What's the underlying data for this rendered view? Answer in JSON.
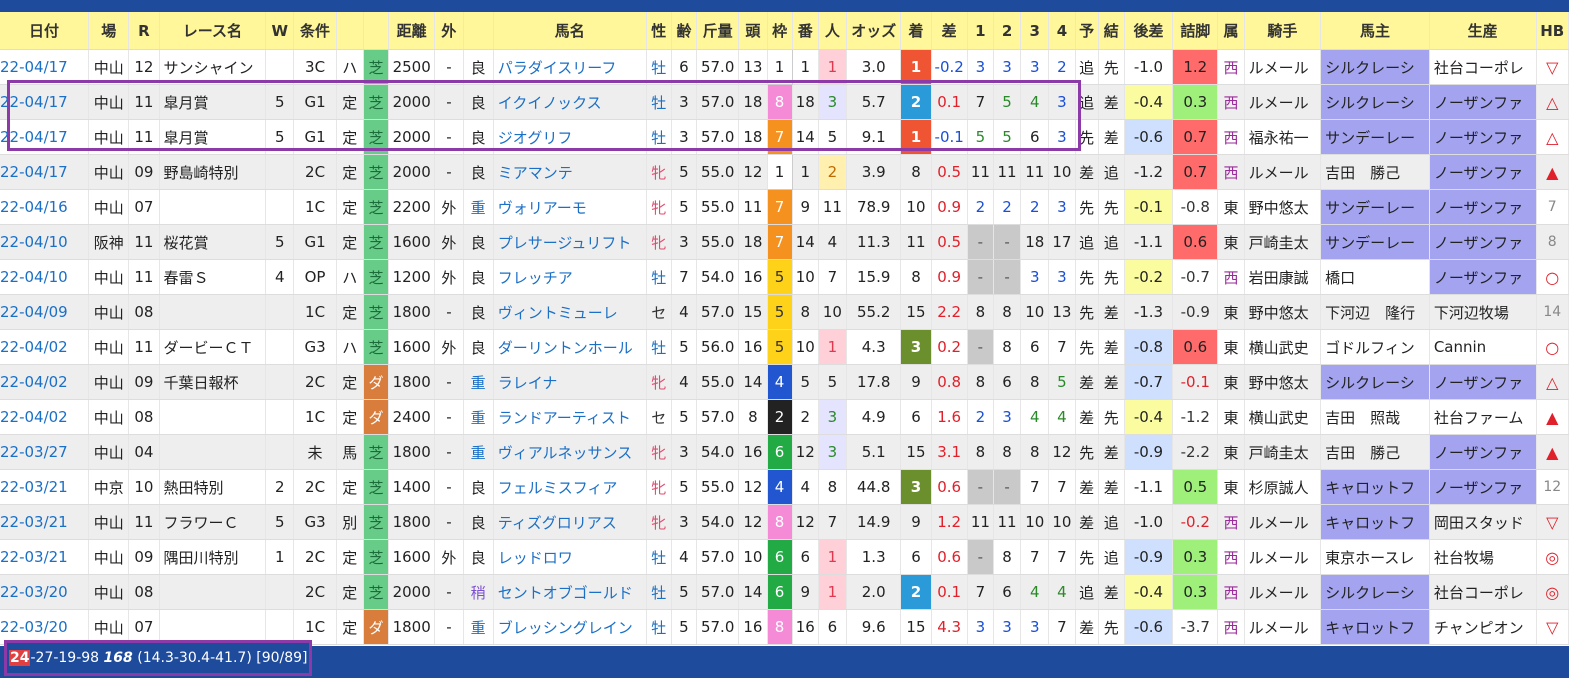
{
  "headers": [
    "日付",
    "場",
    "R",
    "レース名",
    "W",
    "条件",
    "",
    "",
    "距離",
    "外",
    "",
    "馬名",
    "性",
    "齢",
    "斤量",
    "頭",
    "枠",
    "番",
    "人",
    "オッズ",
    "着",
    "差",
    "1",
    "2",
    "3",
    "4",
    "予",
    "結",
    "後差",
    "詰脚",
    "属",
    "騎手",
    "馬主",
    "生産",
    "HB"
  ],
  "rows": [
    {
      "date": "22-04/17",
      "venue": "中山",
      "r": "12",
      "race": "サンシャイン",
      "w": "",
      "grade": "3C",
      "cond": "ハ",
      "surface": "芝",
      "dist": "2500",
      "outer": "-",
      "track": "良",
      "horse": "パラダイスリーフ",
      "sex": "牡",
      "age": "6",
      "weight": "57.0",
      "heads": "13",
      "gate": "1",
      "num": "1",
      "pop": "1",
      "odds": "3.0",
      "finish": "1",
      "diff": "-0.2",
      "c1": "3",
      "c2": "3",
      "c3": "3",
      "c4": "2",
      "pred": "追",
      "res": "先",
      "late": "-1.0",
      "kick": "1.2",
      "belong": "西",
      "jockey": "ルメール",
      "owner": "シルクレーシ",
      "breeder": "社台コーポレ",
      "hb": "▽"
    },
    {
      "date": "22-04/17",
      "venue": "中山",
      "r": "11",
      "race": "皐月賞",
      "w": "5",
      "grade": "G1",
      "cond": "定",
      "surface": "芝",
      "dist": "2000",
      "outer": "-",
      "track": "良",
      "horse": "イクイノックス",
      "sex": "牡",
      "age": "3",
      "weight": "57.0",
      "heads": "18",
      "gate": "8",
      "num": "18",
      "pop": "3",
      "odds": "5.7",
      "finish": "2",
      "diff": "0.1",
      "c1": "7",
      "c2": "5",
      "c3": "4",
      "c4": "3",
      "pred": "追",
      "res": "差",
      "late": "-0.4",
      "kick": "0.3",
      "belong": "西",
      "jockey": "ルメール",
      "owner": "シルクレーシ",
      "breeder": "ノーザンファ",
      "hb": "△"
    },
    {
      "date": "22-04/17",
      "venue": "中山",
      "r": "11",
      "race": "皐月賞",
      "w": "5",
      "grade": "G1",
      "cond": "定",
      "surface": "芝",
      "dist": "2000",
      "outer": "-",
      "track": "良",
      "horse": "ジオグリフ",
      "sex": "牡",
      "age": "3",
      "weight": "57.0",
      "heads": "18",
      "gate": "7",
      "num": "14",
      "pop": "5",
      "odds": "9.1",
      "finish": "1",
      "diff": "-0.1",
      "c1": "5",
      "c2": "5",
      "c3": "6",
      "c4": "3",
      "pred": "先",
      "res": "差",
      "late": "-0.6",
      "kick": "0.7",
      "belong": "西",
      "jockey": "福永祐一",
      "owner": "サンデーレー",
      "breeder": "ノーザンファ",
      "hb": "△"
    },
    {
      "date": "22-04/17",
      "venue": "中山",
      "r": "09",
      "race": "野島崎特別",
      "w": "",
      "grade": "2C",
      "cond": "定",
      "surface": "芝",
      "dist": "2000",
      "outer": "-",
      "track": "良",
      "horse": "ミアマンテ",
      "sex": "牝",
      "age": "5",
      "weight": "55.0",
      "heads": "12",
      "gate": "1",
      "num": "1",
      "pop": "2",
      "odds": "3.9",
      "finish": "8",
      "diff": "0.5",
      "c1": "11",
      "c2": "11",
      "c3": "11",
      "c4": "10",
      "pred": "差",
      "res": "追",
      "late": "-1.2",
      "kick": "0.7",
      "belong": "西",
      "jockey": "ルメール",
      "owner": "吉田　勝己",
      "breeder": "ノーザンファ",
      "hb": "▲"
    },
    {
      "date": "22-04/16",
      "venue": "中山",
      "r": "07",
      "race": "",
      "w": "",
      "grade": "1C",
      "cond": "定",
      "surface": "芝",
      "dist": "2200",
      "outer": "外",
      "track": "重",
      "horse": "ヴォリアーモ",
      "sex": "牝",
      "age": "5",
      "weight": "55.0",
      "heads": "11",
      "gate": "7",
      "num": "9",
      "pop": "11",
      "odds": "78.9",
      "finish": "10",
      "diff": "0.9",
      "c1": "2",
      "c2": "2",
      "c3": "2",
      "c4": "3",
      "pred": "先",
      "res": "先",
      "late": "-0.1",
      "kick": "-0.8",
      "belong": "東",
      "jockey": "野中悠太",
      "owner": "サンデーレー",
      "breeder": "ノーザンファ",
      "hb": "7"
    },
    {
      "date": "22-04/10",
      "venue": "阪神",
      "r": "11",
      "race": "桜花賞",
      "w": "5",
      "grade": "G1",
      "cond": "定",
      "surface": "芝",
      "dist": "1600",
      "outer": "外",
      "track": "良",
      "horse": "プレサージュリフト",
      "sex": "牝",
      "age": "3",
      "weight": "55.0",
      "heads": "18",
      "gate": "7",
      "num": "14",
      "pop": "4",
      "odds": "11.3",
      "finish": "11",
      "diff": "0.5",
      "c1": "-",
      "c2": "-",
      "c3": "18",
      "c4": "17",
      "pred": "追",
      "res": "追",
      "late": "-1.1",
      "kick": "0.6",
      "belong": "東",
      "jockey": "戸崎圭太",
      "owner": "サンデーレー",
      "breeder": "ノーザンファ",
      "hb": "8"
    },
    {
      "date": "22-04/10",
      "venue": "中山",
      "r": "11",
      "race": "春雷Ｓ",
      "w": "4",
      "grade": "OP",
      "cond": "ハ",
      "surface": "芝",
      "dist": "1200",
      "outer": "外",
      "track": "良",
      "horse": "フレッチア",
      "sex": "牡",
      "age": "7",
      "weight": "54.0",
      "heads": "16",
      "gate": "5",
      "num": "10",
      "pop": "7",
      "odds": "15.9",
      "finish": "8",
      "diff": "0.9",
      "c1": "-",
      "c2": "-",
      "c3": "3",
      "c4": "3",
      "pred": "先",
      "res": "先",
      "late": "-0.2",
      "kick": "-0.7",
      "belong": "西",
      "jockey": "岩田康誠",
      "owner": "橋口",
      "breeder": "ノーザンファ",
      "hb": "○"
    },
    {
      "date": "22-04/09",
      "venue": "中山",
      "r": "08",
      "race": "",
      "w": "",
      "grade": "1C",
      "cond": "定",
      "surface": "芝",
      "dist": "1800",
      "outer": "-",
      "track": "良",
      "horse": "ヴィントミューレ",
      "sex": "セ",
      "age": "4",
      "weight": "57.0",
      "heads": "15",
      "gate": "5",
      "num": "8",
      "pop": "10",
      "odds": "55.2",
      "finish": "15",
      "diff": "2.2",
      "c1": "8",
      "c2": "8",
      "c3": "10",
      "c4": "13",
      "pred": "先",
      "res": "差",
      "late": "-1.3",
      "kick": "-0.9",
      "belong": "東",
      "jockey": "野中悠太",
      "owner": "下河辺　隆行",
      "breeder": "下河辺牧場",
      "hb": "14"
    },
    {
      "date": "22-04/02",
      "venue": "中山",
      "r": "11",
      "race": "ダービーＣＴ",
      "w": "",
      "grade": "G3",
      "cond": "ハ",
      "surface": "芝",
      "dist": "1600",
      "outer": "外",
      "track": "良",
      "horse": "ダーリントンホール",
      "sex": "牡",
      "age": "5",
      "weight": "56.0",
      "heads": "16",
      "gate": "5",
      "num": "10",
      "pop": "1",
      "odds": "4.3",
      "finish": "3",
      "diff": "0.2",
      "c1": "-",
      "c2": "8",
      "c3": "6",
      "c4": "7",
      "pred": "先",
      "res": "差",
      "late": "-0.8",
      "kick": "0.6",
      "belong": "東",
      "jockey": "横山武史",
      "owner": "ゴドルフィン",
      "breeder": "Cannin",
      "hb": "○"
    },
    {
      "date": "22-04/02",
      "venue": "中山",
      "r": "09",
      "race": "千葉日報杯",
      "w": "",
      "grade": "2C",
      "cond": "定",
      "surface": "ダ",
      "dist": "1800",
      "outer": "-",
      "track": "重",
      "horse": "ラレイナ",
      "sex": "牝",
      "age": "4",
      "weight": "55.0",
      "heads": "14",
      "gate": "4",
      "num": "5",
      "pop": "5",
      "odds": "17.8",
      "finish": "9",
      "diff": "0.8",
      "c1": "8",
      "c2": "6",
      "c3": "8",
      "c4": "5",
      "pred": "差",
      "res": "差",
      "late": "-0.7",
      "kick": "-0.1",
      "belong": "東",
      "jockey": "野中悠太",
      "owner": "シルクレーシ",
      "breeder": "ノーザンファ",
      "hb": "△"
    },
    {
      "date": "22-04/02",
      "venue": "中山",
      "r": "08",
      "race": "",
      "w": "",
      "grade": "1C",
      "cond": "定",
      "surface": "ダ",
      "dist": "2400",
      "outer": "-",
      "track": "重",
      "horse": "ランドアーティスト",
      "sex": "セ",
      "age": "5",
      "weight": "57.0",
      "heads": "8",
      "gate": "2",
      "num": "2",
      "pop": "3",
      "odds": "4.9",
      "finish": "6",
      "diff": "1.6",
      "c1": "2",
      "c2": "3",
      "c3": "4",
      "c4": "4",
      "pred": "差",
      "res": "先",
      "late": "-0.4",
      "kick": "-1.2",
      "belong": "東",
      "jockey": "横山武史",
      "owner": "吉田　照哉",
      "breeder": "社台ファーム",
      "hb": "▲"
    },
    {
      "date": "22-03/27",
      "venue": "中山",
      "r": "04",
      "race": "",
      "w": "",
      "grade": "未",
      "cond": "馬",
      "surface": "芝",
      "dist": "1800",
      "outer": "-",
      "track": "重",
      "horse": "ヴィアルネッサンス",
      "sex": "牝",
      "age": "3",
      "weight": "54.0",
      "heads": "16",
      "gate": "6",
      "num": "12",
      "pop": "3",
      "odds": "5.1",
      "finish": "15",
      "diff": "3.1",
      "c1": "8",
      "c2": "8",
      "c3": "8",
      "c4": "12",
      "pred": "先",
      "res": "差",
      "late": "-0.9",
      "kick": "-2.2",
      "belong": "東",
      "jockey": "戸崎圭太",
      "owner": "吉田　勝己",
      "breeder": "ノーザンファ",
      "hb": "▲"
    },
    {
      "date": "22-03/21",
      "venue": "中京",
      "r": "10",
      "race": "熱田特別",
      "w": "2",
      "grade": "2C",
      "cond": "定",
      "surface": "芝",
      "dist": "1400",
      "outer": "-",
      "track": "良",
      "horse": "フェルミスフィア",
      "sex": "牝",
      "age": "5",
      "weight": "55.0",
      "heads": "12",
      "gate": "4",
      "num": "4",
      "pop": "8",
      "odds": "44.8",
      "finish": "3",
      "diff": "0.6",
      "c1": "-",
      "c2": "-",
      "c3": "7",
      "c4": "7",
      "pred": "差",
      "res": "差",
      "late": "-1.1",
      "kick": "0.5",
      "belong": "東",
      "jockey": "杉原誠人",
      "owner": "キャロットフ",
      "breeder": "ノーザンファ",
      "hb": "12"
    },
    {
      "date": "22-03/21",
      "venue": "中山",
      "r": "11",
      "race": "フラワーＣ",
      "w": "5",
      "grade": "G3",
      "cond": "別",
      "surface": "芝",
      "dist": "1800",
      "outer": "-",
      "track": "良",
      "horse": "ティズグロリアス",
      "sex": "牝",
      "age": "3",
      "weight": "54.0",
      "heads": "12",
      "gate": "8",
      "num": "12",
      "pop": "7",
      "odds": "14.9",
      "finish": "9",
      "diff": "1.2",
      "c1": "11",
      "c2": "11",
      "c3": "10",
      "c4": "10",
      "pred": "差",
      "res": "追",
      "late": "-1.0",
      "kick": "-0.2",
      "belong": "西",
      "jockey": "ルメール",
      "owner": "キャロットフ",
      "breeder": "岡田スタッド",
      "hb": "▽"
    },
    {
      "date": "22-03/21",
      "venue": "中山",
      "r": "09",
      "race": "隅田川特別",
      "w": "1",
      "grade": "2C",
      "cond": "定",
      "surface": "芝",
      "dist": "1600",
      "outer": "外",
      "track": "良",
      "horse": "レッドロワ",
      "sex": "牡",
      "age": "4",
      "weight": "57.0",
      "heads": "10",
      "gate": "6",
      "num": "6",
      "pop": "1",
      "odds": "1.3",
      "finish": "6",
      "diff": "0.6",
      "c1": "-",
      "c2": "8",
      "c3": "7",
      "c4": "7",
      "pred": "先",
      "res": "追",
      "late": "-0.9",
      "kick": "0.3",
      "belong": "西",
      "jockey": "ルメール",
      "owner": "東京ホースレ",
      "breeder": "社台牧場",
      "hb": "◎"
    },
    {
      "date": "22-03/20",
      "venue": "中山",
      "r": "08",
      "race": "",
      "w": "",
      "grade": "2C",
      "cond": "定",
      "surface": "芝",
      "dist": "2000",
      "outer": "-",
      "track": "稍",
      "horse": "セントオブゴールド",
      "sex": "牡",
      "age": "5",
      "weight": "57.0",
      "heads": "14",
      "gate": "6",
      "num": "9",
      "pop": "1",
      "odds": "2.0",
      "finish": "2",
      "diff": "0.1",
      "c1": "7",
      "c2": "6",
      "c3": "4",
      "c4": "4",
      "pred": "追",
      "res": "差",
      "late": "-0.4",
      "kick": "0.3",
      "belong": "西",
      "jockey": "ルメール",
      "owner": "シルクレーシ",
      "breeder": "社台コーポレ",
      "hb": "◎"
    },
    {
      "date": "22-03/20",
      "venue": "中山",
      "r": "07",
      "race": "",
      "w": "",
      "grade": "1C",
      "cond": "定",
      "surface": "ダ",
      "dist": "1800",
      "outer": "-",
      "track": "重",
      "horse": "ブレッシングレイン",
      "sex": "牡",
      "age": "5",
      "weight": "57.0",
      "heads": "16",
      "gate": "8",
      "num": "16",
      "pop": "6",
      "odds": "9.6",
      "finish": "15",
      "diff": "4.3",
      "c1": "3",
      "c2": "3",
      "c3": "3",
      "c4": "7",
      "pred": "差",
      "res": "先",
      "late": "-0.6",
      "kick": "-3.7",
      "belong": "西",
      "jockey": "ルメール",
      "owner": "キャロットフ",
      "breeder": "チャンピオン",
      "hb": "▽"
    }
  ],
  "status": {
    "wins": "24",
    "rest": "-27-19-98",
    "total": "168",
    "rates": "(14.3-30.4-41.7) [90/89]"
  }
}
